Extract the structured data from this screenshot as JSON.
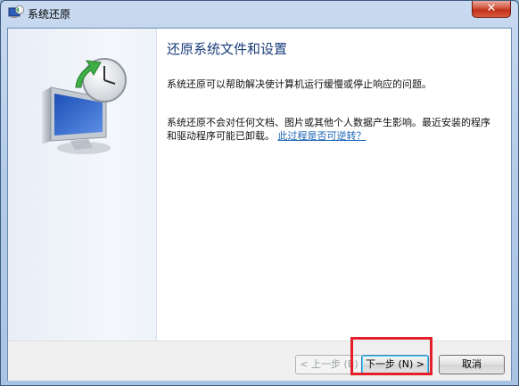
{
  "window": {
    "title": "系统还原",
    "close_icon": "close-icon",
    "close_glyph": "✕"
  },
  "content": {
    "heading": "还原系统文件和设置",
    "paragraph1": "系统还原可以帮助解决使计算机运行缓慢或停止响应的问题。",
    "paragraph2": "系统还原不会对任何文档、图片或其他个人数据产生影响。最近安装的程序和驱动程序可能已卸载。",
    "link": "此过程是否可逆转？"
  },
  "buttons": {
    "back": "< 上一步 (B)",
    "next": "下一步 (N) >",
    "cancel": "取消"
  },
  "icons": {
    "title": "system-restore-icon",
    "illustration": "computer-clock-restore-icon"
  },
  "colors": {
    "heading": "#1b3d7a",
    "link": "#1a64b5",
    "highlight": "#e3202a"
  }
}
